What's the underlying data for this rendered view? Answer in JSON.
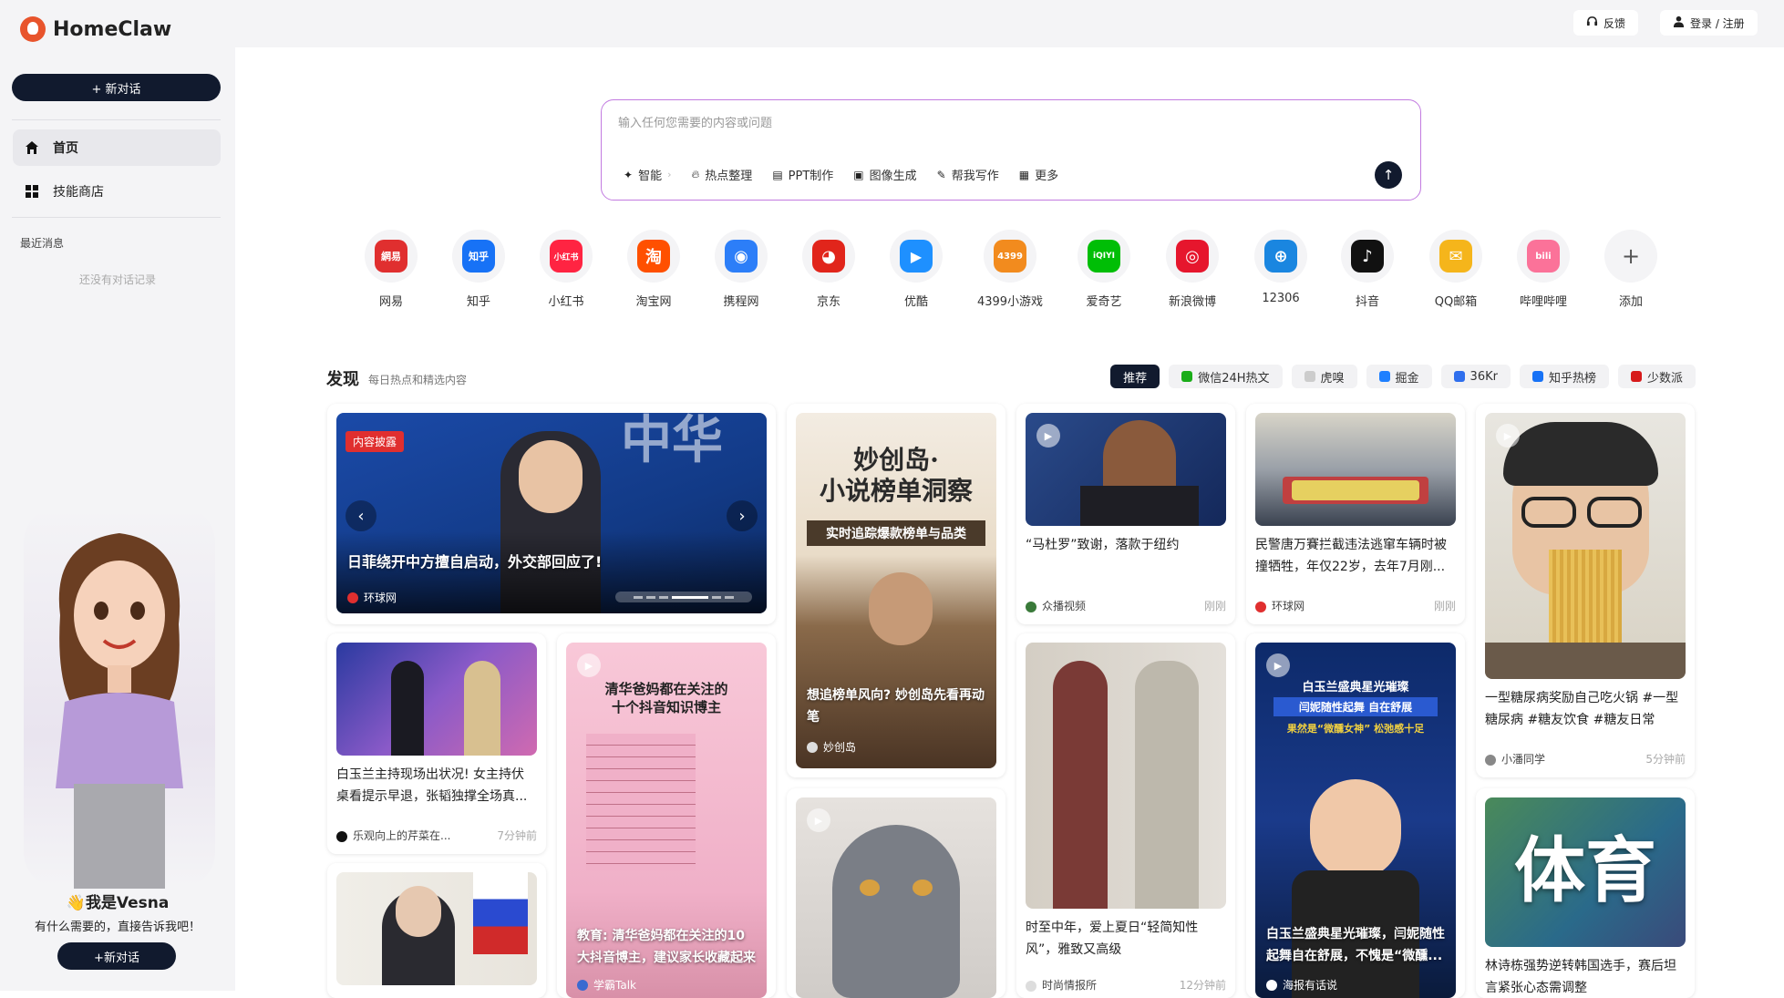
{
  "app": {
    "brand": "HomeClaw"
  },
  "sidebar": {
    "new_chat_label": "+ 新对话",
    "nav": [
      {
        "label": "首页",
        "icon": "home-icon"
      },
      {
        "label": "技能商店",
        "icon": "grid-icon"
      }
    ],
    "recent_title": "最近消息",
    "recent_empty": "还没有对话记录",
    "assistant": {
      "greeting": "👋我是Vesna",
      "subtitle": "有什么需要的，直接告诉我吧！",
      "button": "+新对话"
    }
  },
  "topbar": {
    "feedback": "反馈",
    "login": "登录 / 注册"
  },
  "search": {
    "placeholder": "输入任何您需要的内容或问题",
    "tools": [
      {
        "label": "智能",
        "icon": "sparkle-icon"
      },
      {
        "label": "热点整理",
        "icon": "flame-icon"
      },
      {
        "label": "PPT制作",
        "icon": "document-icon"
      },
      {
        "label": "图像生成",
        "icon": "image-icon"
      },
      {
        "label": "帮我写作",
        "icon": "pen-icon"
      },
      {
        "label": "更多",
        "icon": "grid-icon"
      }
    ]
  },
  "apps": [
    {
      "label": "网易",
      "glyph": "網易",
      "color": "#e02f2f"
    },
    {
      "label": "知乎",
      "glyph": "知乎",
      "color": "#1772f6"
    },
    {
      "label": "小红书",
      "glyph": "小红书",
      "color": "#ff2442"
    },
    {
      "label": "淘宝网",
      "glyph": "淘",
      "color": "#ff5000"
    },
    {
      "label": "携程网",
      "glyph": "◉",
      "color": "#2c7ef8"
    },
    {
      "label": "京东",
      "glyph": "◕",
      "color": "#e1251b"
    },
    {
      "label": "优酷",
      "glyph": "▶",
      "color": "#1e90ff"
    },
    {
      "label": "4399小游戏",
      "glyph": "4399",
      "color": "#f28b1e"
    },
    {
      "label": "爱奇艺",
      "glyph": "iQIYI",
      "color": "#00be06"
    },
    {
      "label": "新浪微博",
      "glyph": "◎",
      "color": "#e6162d"
    },
    {
      "label": "12306",
      "glyph": "⊕",
      "color": "#1a86e0"
    },
    {
      "label": "抖音",
      "glyph": "♪",
      "color": "#111111"
    },
    {
      "label": "QQ邮箱",
      "glyph": "✉",
      "color": "#f5b51b"
    },
    {
      "label": "哔哩哔哩",
      "glyph": "bili",
      "color": "#fb7299"
    },
    {
      "label": "添加",
      "glyph": "+",
      "color": "#f4f4f6"
    }
  ],
  "discover": {
    "title": "发现",
    "subtitle": "每日热点和精选内容",
    "tabs": [
      {
        "label": "推荐",
        "color": ""
      },
      {
        "label": "微信24H热文",
        "color": "#1aad19"
      },
      {
        "label": "虎嗅",
        "color": "#cccccc"
      },
      {
        "label": "掘金",
        "color": "#1e80ff"
      },
      {
        "label": "36Kr",
        "color": "#2f6fed"
      },
      {
        "label": "知乎热榜",
        "color": "#1772f6"
      },
      {
        "label": "少数派",
        "color": "#d71a1b"
      }
    ]
  },
  "cards": {
    "hero": {
      "badge": "内容披露",
      "title": "日菲绕开中方擅自启动，外交部回应了!",
      "source": "环球网"
    },
    "novel": {
      "poster_line1": "妙创岛·",
      "poster_line2": "小说榜单洞察",
      "poster_sub": "实时追踪爆款榜单与品类",
      "title": "想追榜单风向? 妙创岛先看再动笔",
      "source": "妙创岛"
    },
    "maduro": {
      "title": "“马杜罗”致谢，落款于纽约",
      "source": "众播视频",
      "time": "刚刚"
    },
    "police": {
      "title": "民警唐万賽拦截违法逃窜车辆时被撞牺牲，年仅22岁，去年7月刚...",
      "source": "环球网",
      "time": "刚刚"
    },
    "noodle": {
      "title": "一型糖尿病奖励自己吃火锅 #一型糖尿病 #糖友饮食 #糖友日常",
      "source": "小潘同学",
      "time": "5分钟前"
    },
    "host": {
      "title": "白玉兰主持现场出状况! 女主持伏桌看提示早退，张韬独撑全场真...",
      "source": "乐观向上的芹菜在...",
      "time": "7分钟前"
    },
    "edu": {
      "poster_line1": "清华爸妈都在关注的",
      "poster_line2": "十个抖音知识博主",
      "title": "教育: 清华爸妈都在关注的10大抖音博主，建议家长收藏起来",
      "source": "学霸Talk"
    },
    "fashion": {
      "title": "时至中年，爱上夏日“轻简知性风”，雅致又高级",
      "source": "时尚情报所",
      "time": "12分钟前"
    },
    "magnolia": {
      "poster_line1": "白玉兰盛典星光璀璨",
      "poster_line2": "闫妮随性起舞 自在舒展",
      "poster_line3": "果然是“微醺女神” 松弛感十足",
      "title": "白玉兰盛典星光璀璨，闫妮随性起舞自在舒展，不愧是“微醺...",
      "source": "海报有话说"
    },
    "sports": {
      "poster": "体育",
      "title": "林诗栋强势逆转韩国选手，赛后坦言紧张心态需调整"
    }
  }
}
